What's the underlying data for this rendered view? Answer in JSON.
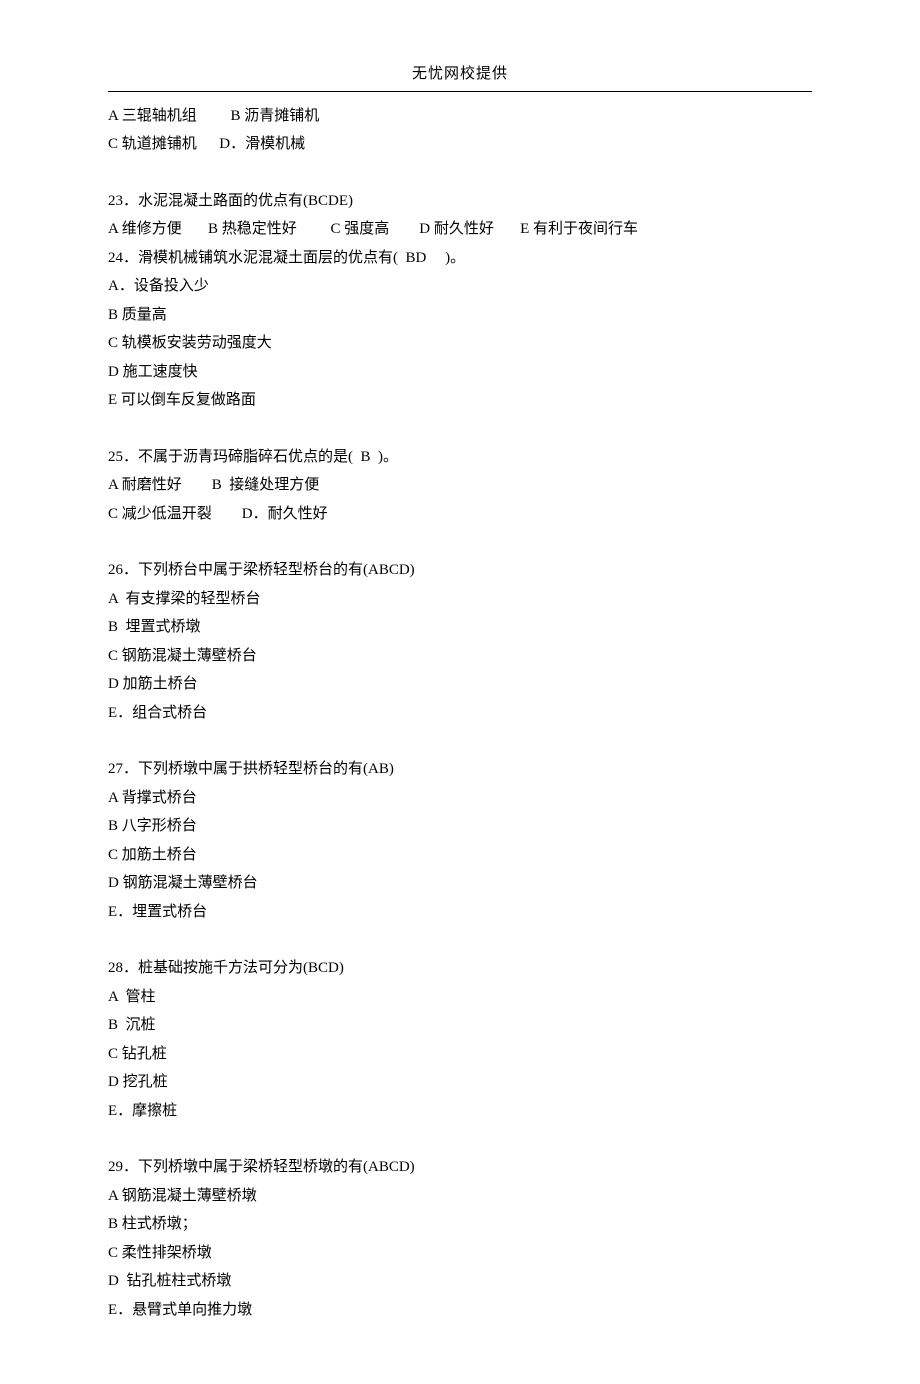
{
  "header": {
    "provider": "无忧网校提供"
  },
  "q22_tail": {
    "lineA": "A 三辊轴机组         B 沥青摊铺机",
    "lineB": "C 轨道摊铺机      D．滑模机械"
  },
  "q23": {
    "stem": "23．水泥混凝土路面的优点有(BCDE)",
    "opts": "A 维修方便       B 热稳定性好         C 强度高        D 耐久性好       E 有利于夜间行车"
  },
  "q24": {
    "stem": "24．滑模机械铺筑水泥混凝土面层的优点有(  BD     )。",
    "a": "A．设备投入少",
    "b": "B 质量高",
    "c": "C 轨模板安装劳动强度大",
    "d": "D 施工速度快",
    "e": "E 可以倒车反复做路面"
  },
  "q25": {
    "stem": "25．不属于沥青玛碲脂碎石优点的是(  B  )。",
    "line1": "A 耐磨性好        B  接缝处理方便",
    "line2": "C 减少低温开裂        D．耐久性好"
  },
  "q26": {
    "stem": "26．下列桥台中属于梁桥轻型桥台的有(ABCD)",
    "a": "A  有支撑梁的轻型桥台",
    "b": "B  埋置式桥墩",
    "c": "C 钢筋混凝土薄壁桥台",
    "d": "D 加筋土桥台",
    "e": "E．组合式桥台"
  },
  "q27": {
    "stem": "27．下列桥墩中属于拱桥轻型桥台的有(AB)",
    "a": "A 背撑式桥台",
    "b": "B 八字形桥台",
    "c": "C 加筋土桥台",
    "d": "D 钢筋混凝土薄壁桥台",
    "e": "E．埋置式桥台"
  },
  "q28": {
    "stem": "28．桩基础按施千方法可分为(BCD)",
    "a": "A  管柱",
    "b": "B  沉桩",
    "c": "C 钻孔桩",
    "d": "D 挖孔桩",
    "e": "E．摩擦桩"
  },
  "q29": {
    "stem": "29．下列桥墩中属于梁桥轻型桥墩的有(ABCD)",
    "a": "A 钢筋混凝土薄壁桥墩",
    "b": "B 柱式桥墩；",
    "c": "C 柔性排架桥墩",
    "d": "D  钻孔桩柱式桥墩",
    "e": "E．悬臂式单向推力墩"
  }
}
